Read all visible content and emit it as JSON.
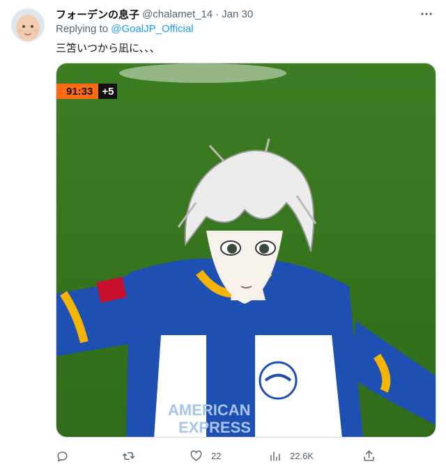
{
  "tweet": {
    "author": {
      "display_name": "フォーデンの息子",
      "handle": "@chalamet_14",
      "avatar_icon": "baby-face-photo"
    },
    "separator": "·",
    "date": "Jan 30",
    "reply_prefix": "Replying to",
    "reply_to": "@GoalJP_Official",
    "text": "三笘いつから凪に、、、",
    "media": {
      "clock_time": "91:33",
      "clock_added": "+5",
      "jersey_text_1": "AMERICAN",
      "jersey_text_2": "EXPRESS",
      "colors": {
        "pitch": "#3b7a1f",
        "jersey_blue": "#1e50b4",
        "trim_yellow": "#f4b400",
        "clock_orange": "#ff6a13"
      }
    },
    "more_icon": "more-horizontal-icon"
  },
  "actions": {
    "reply": {
      "icon": "reply-icon",
      "count": ""
    },
    "retweet": {
      "icon": "retweet-icon",
      "count": ""
    },
    "like": {
      "icon": "heart-icon",
      "count": "22"
    },
    "views": {
      "icon": "bar-chart-icon",
      "count": "22.6K"
    },
    "share": {
      "icon": "share-icon",
      "count": ""
    }
  }
}
